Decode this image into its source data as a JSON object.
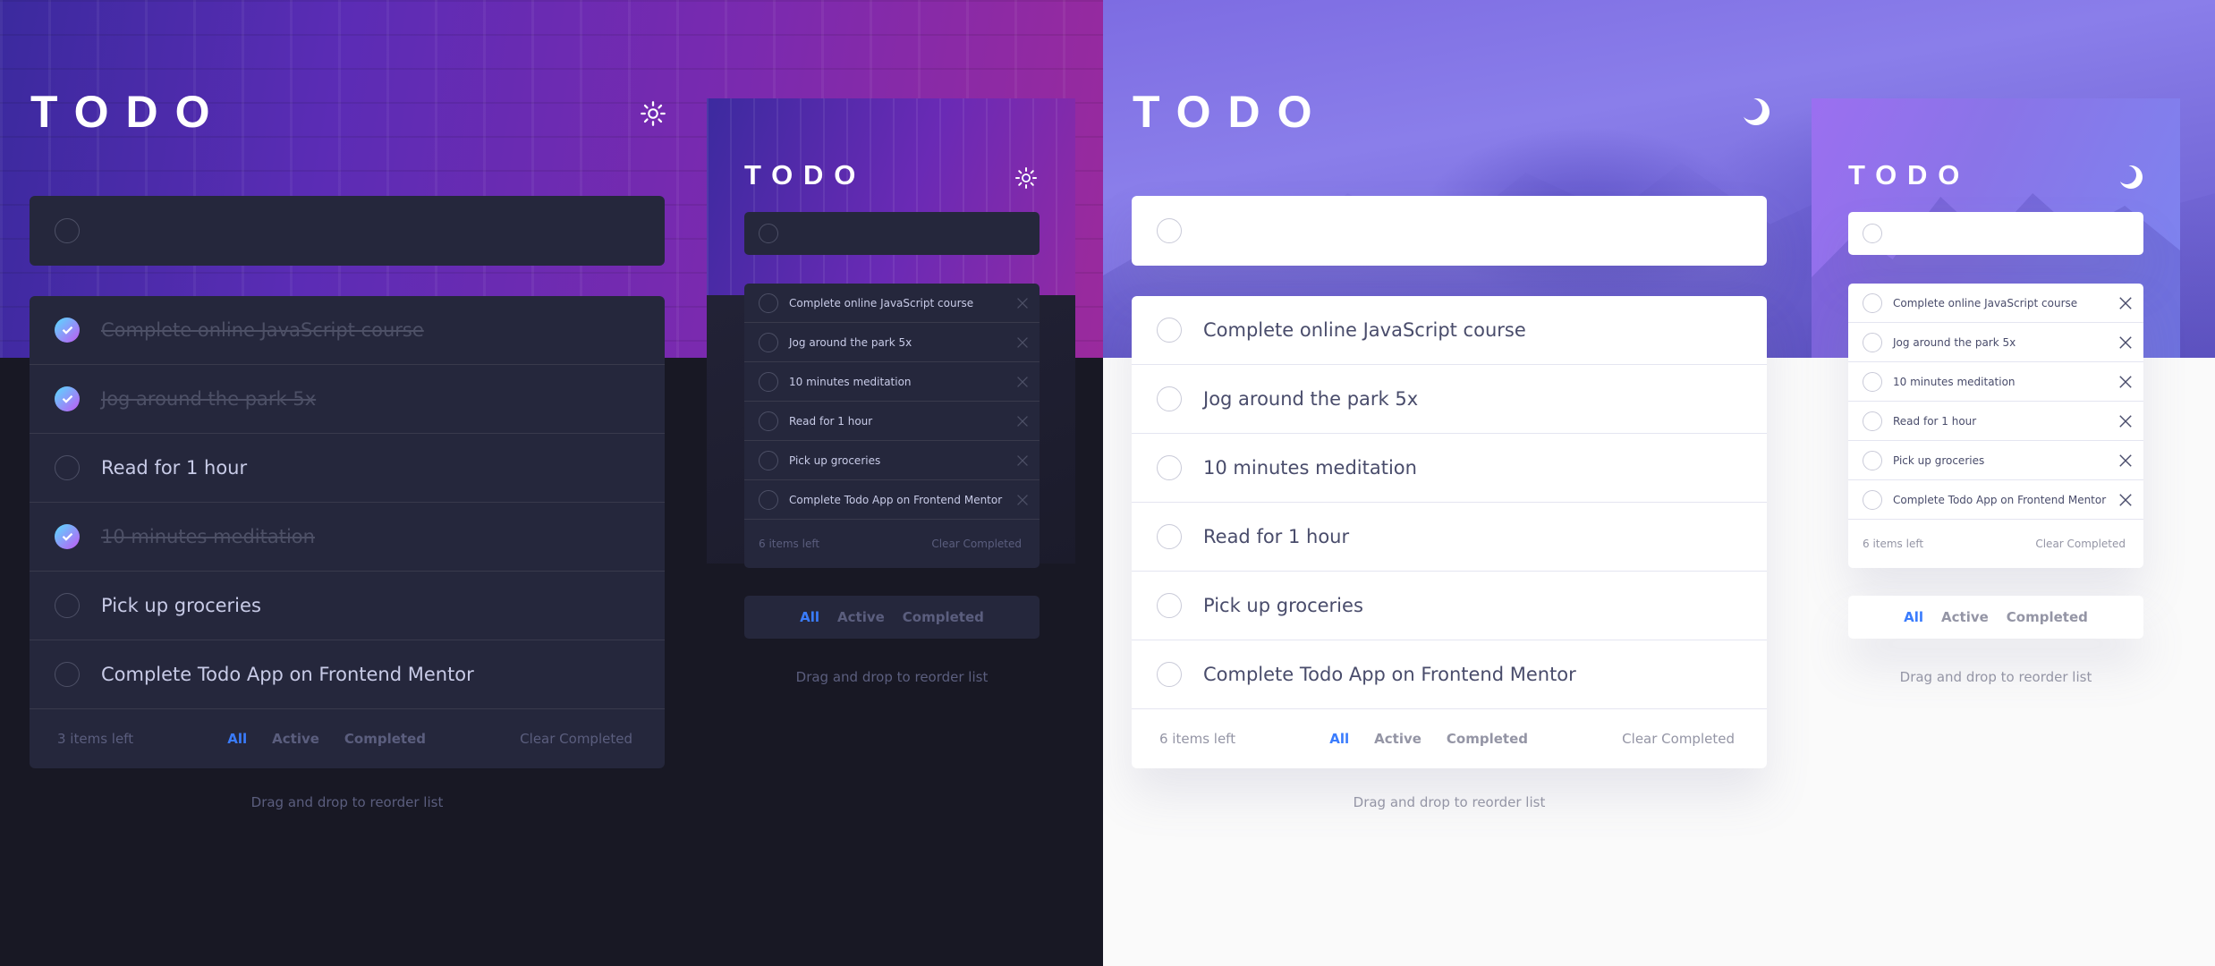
{
  "dark": {
    "logo": "TODO",
    "theme_icon": "sun-icon",
    "input_placeholder": "",
    "desktop_items": [
      {
        "text": "Complete online JavaScript course",
        "done": true
      },
      {
        "text": "Jog around the park 5x",
        "done": true
      },
      {
        "text": "Read for 1 hour",
        "done": false
      },
      {
        "text": "10 minutes meditation",
        "done": true
      },
      {
        "text": "Pick up groceries",
        "done": false
      },
      {
        "text": "Complete Todo App on Frontend Mentor",
        "done": false
      }
    ],
    "mobile_items": [
      {
        "text": "Complete online JavaScript course",
        "done": false
      },
      {
        "text": "Jog around the park 5x",
        "done": false
      },
      {
        "text": "10 minutes meditation",
        "done": false
      },
      {
        "text": "Read for 1 hour",
        "done": false
      },
      {
        "text": "Pick up groceries",
        "done": false
      },
      {
        "text": "Complete Todo App on Frontend Mentor",
        "done": false
      }
    ],
    "desktop_items_left": "3 items left",
    "mobile_items_left": "6 items left",
    "filters": {
      "all": "All",
      "active": "Active",
      "completed": "Completed",
      "selected": "All"
    },
    "clear_completed": "Clear Completed",
    "hint": "Drag and drop to reorder list",
    "colors": {
      "bg": "#181824",
      "card": "#25273c",
      "accent": "#3a7cfd"
    }
  },
  "light": {
    "logo": "TODO",
    "theme_icon": "moon-icon",
    "input_placeholder": "",
    "desktop_items": [
      {
        "text": "Complete online JavaScript course",
        "done": false
      },
      {
        "text": "Jog around the park 5x",
        "done": false
      },
      {
        "text": "10 minutes meditation",
        "done": false
      },
      {
        "text": "Read for 1 hour",
        "done": false
      },
      {
        "text": "Pick up groceries",
        "done": false
      },
      {
        "text": "Complete Todo App on Frontend Mentor",
        "done": false
      }
    ],
    "mobile_items": [
      {
        "text": "Complete online JavaScript course",
        "done": false
      },
      {
        "text": "Jog around the park 5x",
        "done": false
      },
      {
        "text": "10 minutes meditation",
        "done": false
      },
      {
        "text": "Read for 1 hour",
        "done": false
      },
      {
        "text": "Pick up groceries",
        "done": false
      },
      {
        "text": "Complete Todo App on Frontend Mentor",
        "done": false
      }
    ],
    "desktop_items_left": "6 items left",
    "mobile_items_left": "6 items left",
    "filters": {
      "all": "All",
      "active": "Active",
      "completed": "Completed",
      "selected": "All"
    },
    "clear_completed": "Clear Completed",
    "hint": "Drag and drop to reorder list",
    "colors": {
      "bg": "#fafafa",
      "card": "#ffffff",
      "accent": "#3a7cfd"
    }
  }
}
